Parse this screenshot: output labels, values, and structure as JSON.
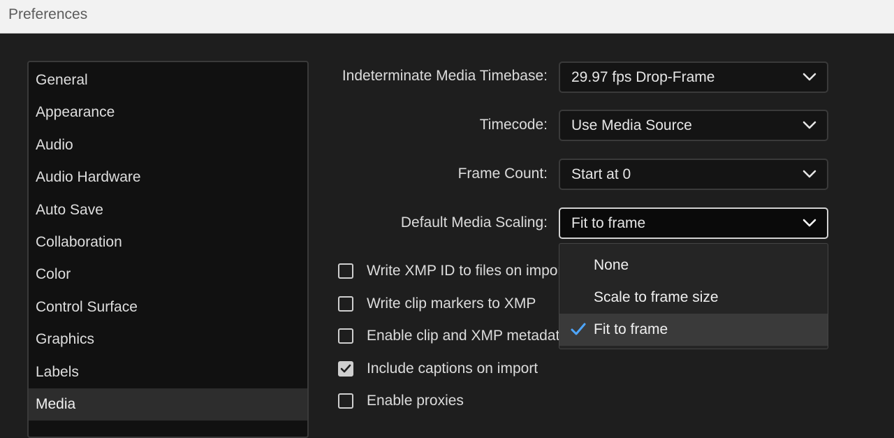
{
  "window": {
    "title": "Preferences"
  },
  "sidebar": {
    "items": [
      {
        "label": "General",
        "selected": false
      },
      {
        "label": "Appearance",
        "selected": false
      },
      {
        "label": "Audio",
        "selected": false
      },
      {
        "label": "Audio Hardware",
        "selected": false
      },
      {
        "label": "Auto Save",
        "selected": false
      },
      {
        "label": "Collaboration",
        "selected": false
      },
      {
        "label": "Color",
        "selected": false
      },
      {
        "label": "Control Surface",
        "selected": false
      },
      {
        "label": "Graphics",
        "selected": false
      },
      {
        "label": "Labels",
        "selected": false
      },
      {
        "label": "Media",
        "selected": true
      }
    ]
  },
  "settings": {
    "timebase": {
      "label": "Indeterminate Media Timebase:",
      "value": "29.97 fps Drop-Frame"
    },
    "timecode": {
      "label": "Timecode:",
      "value": "Use Media Source"
    },
    "frame_count": {
      "label": "Frame Count:",
      "value": "Start at 0"
    },
    "scaling": {
      "label": "Default Media Scaling:",
      "value": "Fit to frame",
      "options": [
        {
          "label": "None",
          "selected": false
        },
        {
          "label": "Scale to frame size",
          "selected": false
        },
        {
          "label": "Fit to frame",
          "selected": true
        }
      ]
    }
  },
  "checkboxes": [
    {
      "label": "Write XMP ID to files on import",
      "checked": false
    },
    {
      "label": "Write clip markers to XMP",
      "checked": false
    },
    {
      "label": "Enable clip and XMP metadata linking",
      "checked": false
    },
    {
      "label": "Include captions on import",
      "checked": true
    },
    {
      "label": "Enable proxies",
      "checked": false
    }
  ],
  "colors": {
    "background": "#1e1e1e",
    "titlebar": "#f2f2f2",
    "accent_check": "#4ea6ff"
  }
}
